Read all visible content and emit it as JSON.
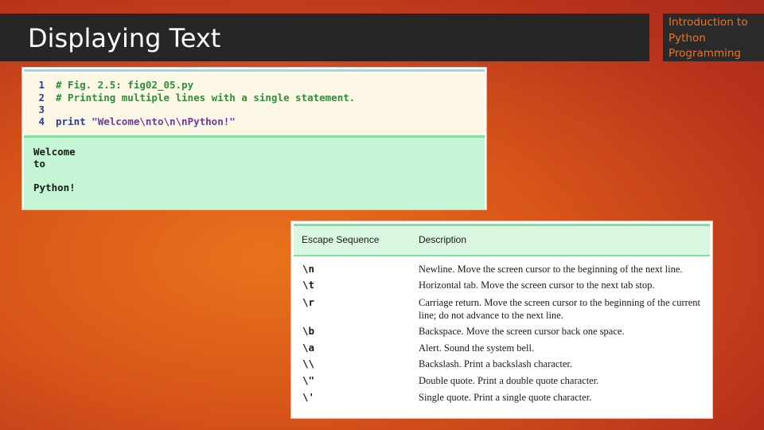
{
  "slide": {
    "title": "Displaying Text",
    "course_label": "Introduction to Python Programming"
  },
  "code_panel": {
    "lines": [
      {
        "num": "1",
        "text": "# Fig. 2.5: fig02_05.py"
      },
      {
        "num": "2",
        "text": "# Printing multiple lines with a single statement."
      },
      {
        "num": "3",
        "text": ""
      },
      {
        "num": "4",
        "keyword": "print",
        "string": "\"Welcome\\nto\\n\\nPython!\""
      }
    ],
    "output_lines": [
      "Welcome",
      "to",
      "",
      "Python!"
    ]
  },
  "escape_table": {
    "headers": [
      "Escape Sequence",
      "Description"
    ],
    "rows": [
      {
        "seq": "\\n",
        "desc": "Newline. Move the screen cursor to the beginning of the next line."
      },
      {
        "seq": "\\t",
        "desc": "Horizontal tab. Move the screen cursor to the next tab stop."
      },
      {
        "seq": "\\r",
        "desc": "Carriage return. Move the screen cursor to the beginning of the current line; do not advance to the next line."
      },
      {
        "seq": "\\b",
        "desc": "Backspace. Move the screen cursor back one space."
      },
      {
        "seq": "\\a",
        "desc": "Alert. Sound the system bell."
      },
      {
        "seq": "\\\\",
        "desc": "Backslash. Print a backslash character."
      },
      {
        "seq": "\\\"",
        "desc": "Double quote. Print a double quote character."
      },
      {
        "seq": "\\'",
        "desc": "Single quote. Print a single quote character."
      }
    ]
  },
  "colors": {
    "title_bar": "#262626",
    "course_text": "#f0731e",
    "code_background": "#fdf7e6",
    "output_background": "#c4f5d4",
    "comment": "#2f8f3a",
    "keyword": "#2a3d8f",
    "string": "#6b3aa0"
  }
}
